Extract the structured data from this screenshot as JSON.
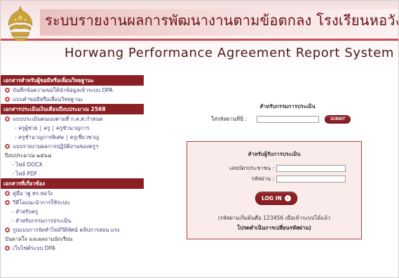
{
  "header": {
    "title_th": "ระบบรายงานผลการพัฒนางานตามข้อตกลง โรงเรียนหอวัง",
    "title_en": "Horwang Performance Agreement Report System",
    "logo_icon": "school-emblem-icon",
    "colors": {
      "brand": "#8c1f24",
      "stripe": "#c94f55",
      "title": "#6b0f13"
    }
  },
  "sidebar": {
    "sections": [
      {
        "title": "เอกสารสำหรับผู้ขอมีหรือเลื่อนวิทยฐานะ",
        "items": [
          "บันทึกข้อความขอให้นำข้อมูลเข้าระบบ DPA",
          "แบบคำขอมีหรือเลื่อนวิทยฐานะ"
        ]
      },
      {
        "title": "เอกสารประเมินเงินเดือนปีงบประมาณ 2568",
        "item_main": "แบบประเมินตนเองตามที่ ก.ค.ศ.กำหนด",
        "subs_row1": [
          "ครูผู้ช่วย",
          "ครู",
          "ครูชำนาญการ"
        ],
        "subs_row2": [
          "ครูชำนาญการพิเศษ",
          "ครูเชี่ยวชาญ"
        ],
        "item_report_1": "แบบรายงานผลการปฏิบัติงานของครูฯ",
        "item_report_2": "ปีงบประมาณ ๒๕๖๘",
        "files": [
          "- ไฟล์ DOCX",
          "- ไฟล์ PDF"
        ]
      },
      {
        "title": "เอกสารที่เกี่ยวข้อง",
        "items": [
          "คู่มือ วฐ ทร.หอวัง",
          "วีดีโอแนะนำการใช้ระบบ"
        ],
        "video_subs": [
          "- สำหรับครู",
          "- สำหรับกรรมการประเมิน"
        ],
        "item_format_1": "รูปแบบการจัดทำไฟล์วีดิทัศน์ คลิปการสอน แรง",
        "item_format_2": "บันดาลใจ และผลงานนักเรียน",
        "item_last": "เว็บไซต์ระบบ DPA"
      }
    ]
  },
  "committee": {
    "title": "สำหรับกรรมการประเมิน",
    "password_label": "ใส่รหัสผ่านที่นี่ :",
    "password_value": "",
    "submit_label": "SUBMIT"
  },
  "login": {
    "title": "สำหรับผู้รับการประเมิน",
    "id_label": "เลขบัตรประชาชน :",
    "id_value": "",
    "password_label": "รหัสผ่าน :",
    "password_value": "",
    "login_label": "LOG IN",
    "login_arrow": "›",
    "note_line1": "(รหัสผ่านเริ่มต้นคือ 123456  เมื่อเข้าระบบได้แล้ว",
    "note_line2": "โปรดดำเนินการเปลี่ยนรหัสผ่าน)"
  }
}
